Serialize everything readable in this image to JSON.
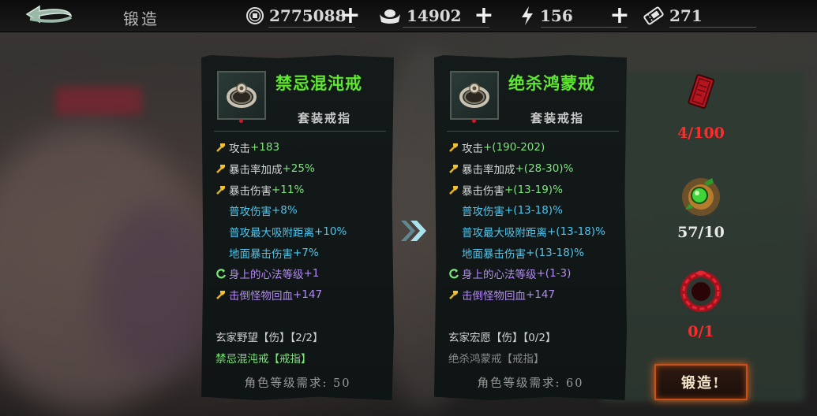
{
  "header": {
    "title": "锻造",
    "resources": [
      {
        "icon": "coin-icon",
        "value": "2775088"
      },
      {
        "icon": "ingot-icon",
        "value": "14902"
      },
      {
        "icon": "lightning-icon",
        "value": "156"
      },
      {
        "icon": "ticket-icon",
        "value": "271"
      }
    ]
  },
  "left_item": {
    "name": "禁忌混沌戒",
    "type": "套装戒指",
    "stats": [
      {
        "name": "攻击",
        "value": "+183",
        "kind": "main"
      },
      {
        "name": "暴击率加成",
        "value": "+25%",
        "kind": "main"
      },
      {
        "name": "暴击伤害",
        "value": "+11%",
        "kind": "main"
      },
      {
        "name": "普攻伤害",
        "value": "+8%",
        "kind": "sub"
      },
      {
        "name": "普攻最大吸附距离",
        "value": "+10%",
        "kind": "sub"
      },
      {
        "name": "地面暴击伤害",
        "value": "+7%",
        "kind": "sub"
      },
      {
        "name": "身上的心法等级",
        "value": "+1",
        "kind": "skill"
      },
      {
        "name": "击倒怪物回血",
        "value": "+147",
        "kind": "kill"
      }
    ],
    "set_line": "玄家野望【伤】【2/2】",
    "set_piece": "禁忌混沌戒【戒指】",
    "requirement": "角色等级需求: 50"
  },
  "right_item": {
    "name": "绝杀鸿蒙戒",
    "type": "套装戒指",
    "stats": [
      {
        "name": "攻击",
        "value": "+(190-202)",
        "kind": "main"
      },
      {
        "name": "暴击率加成",
        "value": "+(28-30)%",
        "kind": "main"
      },
      {
        "name": "暴击伤害",
        "value": "+(13-19)%",
        "kind": "main"
      },
      {
        "name": "普攻伤害",
        "value": "+(13-18)%",
        "kind": "sub"
      },
      {
        "name": "普攻最大吸附距离",
        "value": "+(13-18)%",
        "kind": "sub"
      },
      {
        "name": "地面暴击伤害",
        "value": "+(13-18)%",
        "kind": "sub"
      },
      {
        "name": "身上的心法等级",
        "value": "+(1-3)",
        "kind": "skill"
      },
      {
        "name": "击倒怪物回血",
        "value": "+147",
        "kind": "kill"
      }
    ],
    "set_line": "玄家宏愿【伤】【0/2】",
    "set_piece": "绝杀鸿蒙戒【戒指】",
    "requirement": "角色等级需求: 60"
  },
  "materials": [
    {
      "icon": "red-book-icon",
      "count": "4/100",
      "color": "#ff2b2b"
    },
    {
      "icon": "green-gem-icon",
      "count": "57/10",
      "color": "#e8e8e8"
    },
    {
      "icon": "red-ring-icon",
      "count": "0/1",
      "color": "#ff2b2b"
    }
  ],
  "forge_button": "锻造!",
  "colors": {
    "item_name": "#5ee630",
    "main_stat_value": "#7de57a",
    "sub_stat": "#4fc6ee",
    "skill_stat": "#b28bf2",
    "set_piece_active": "#7de57a",
    "set_piece_inactive": "#8a8a8a"
  }
}
